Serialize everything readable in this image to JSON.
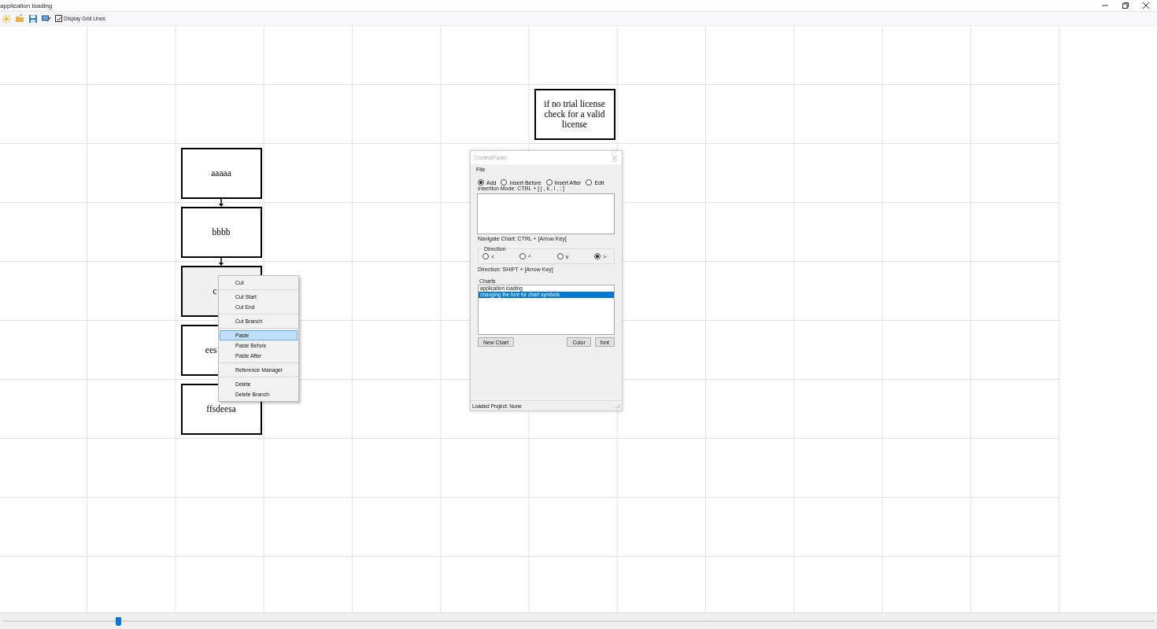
{
  "window": {
    "title": "application loading"
  },
  "toolbar": {
    "display_grid_lines": {
      "label": "Display Grid Lines",
      "checked": true
    }
  },
  "chart": {
    "nodes": [
      {
        "label": "aaaaa",
        "arrow_below": true,
        "covered": false,
        "selected": false
      },
      {
        "label": "bbbb",
        "arrow_below": true,
        "covered": false,
        "selected": false
      },
      {
        "label": "c",
        "arrow_below": false,
        "covered": true,
        "selected": true
      },
      {
        "label": "ees",
        "arrow_below": false,
        "covered": true,
        "selected": false
      },
      {
        "label": "ffsdeesa",
        "arrow_below": false,
        "covered": false,
        "selected": false
      },
      {
        "label": "if no trial license check for a valid license",
        "arrow_below": false,
        "covered": false,
        "selected": false
      }
    ]
  },
  "context_menu": {
    "groups": [
      [
        {
          "label": "Cut",
          "selected": false
        }
      ],
      [
        {
          "label": "Cut Start",
          "selected": false
        },
        {
          "label": "Cut End",
          "selected": false
        }
      ],
      [
        {
          "label": "Cut Branch",
          "selected": false
        }
      ],
      [
        {
          "label": "Paste",
          "selected": true
        },
        {
          "label": "Paste Before",
          "selected": false
        },
        {
          "label": "Paste After",
          "selected": false
        }
      ],
      [
        {
          "label": "Reference Manager",
          "selected": false
        }
      ],
      [
        {
          "label": "Delete",
          "selected": false
        },
        {
          "label": "Delete Branch",
          "selected": false
        }
      ]
    ]
  },
  "control_panel": {
    "title": "ControlPanel",
    "menu": [
      "File"
    ],
    "modes": [
      {
        "label": "Add",
        "selected": true
      },
      {
        "label": "Insert Before",
        "selected": false
      },
      {
        "label": "Insert After",
        "selected": false
      },
      {
        "label": "Edit",
        "selected": false
      }
    ],
    "insertion_hint": "Insertion Mode: CTRL + [ j , k , l , ; ]",
    "navigate_hint": "Navigate Chart: CTRL + [Arrow Key]",
    "direction": {
      "title": "Direction",
      "options": [
        {
          "label": "<",
          "selected": false
        },
        {
          "label": "^",
          "selected": false
        },
        {
          "label": "v",
          "selected": false
        },
        {
          "label": ">",
          "selected": true
        }
      ]
    },
    "direction_hint": "Direction: SHIFT + [Arrow Key]",
    "charts": {
      "title": "Charts",
      "items": [
        {
          "label": "application loading",
          "selected": false
        },
        {
          "label": "changing the font for chart symbols",
          "selected": true
        }
      ]
    },
    "buttons": {
      "new_chart_button": "New Chart",
      "color_button": "Color",
      "font_button": "font"
    },
    "status": "Loaded Project: None"
  },
  "zoom_slider": {
    "level": 0.1
  }
}
